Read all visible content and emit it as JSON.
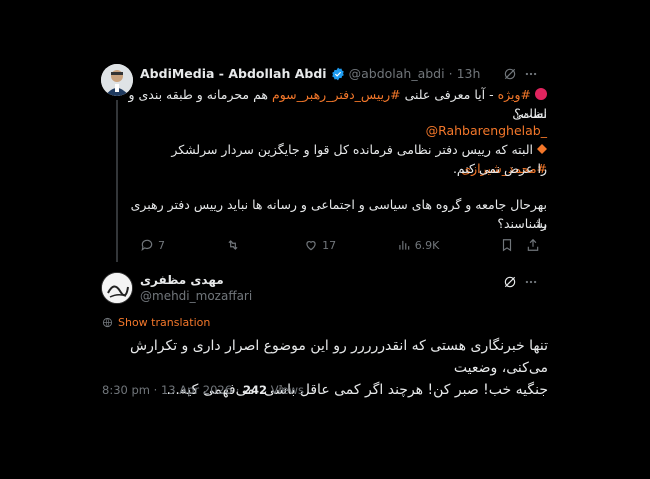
{
  "tweet1": {
    "display_name": "AbdiMedia - Abdollah Abdi",
    "handle": "@abdolah_abdi",
    "dot": "·",
    "time": "13h",
    "line1_prefix": "#ویژه",
    "line1_text_a": " - آیا معرفی علنی ",
    "line1_hashtag": "#رییس_دفتر_رهبر_سوم",
    "line1_text_b": " هم محرمانه و طبقه بندی و نظامی",
    "line2": "است؟",
    "mention": "@Rahbarenghelab_",
    "para2_text_a": "البته که رییس دفتر نظامی فرمانده کل قوا و جایگزین سردار سرلشکر ",
    "para2_hashtag": "#محمد_شیرازی",
    "para2_line2": "را عرض نمی کنم.",
    "para3_line1": "بهرحال جامعه و گروه های سیاسی و اجتماعی و رسانه ها نباید رییس دفتر رهبری را",
    "para3_line2": "بشناسند؟",
    "actions": {
      "replies": "7",
      "retweets": "",
      "likes": "17",
      "views": "6.9K"
    }
  },
  "tweet2": {
    "display_name": "مهدی مظفری",
    "handle": "@mehdi_mozaffari",
    "show_translation": "Show translation",
    "body_line1": "تنها خبرنگاری هستی که انقدررررر رو این موضوع اصرار داری و تکرارش می‌کنی، وضعیت",
    "body_line2": "جنگیه خب! صبر کن! هرچند اگر کمی عاقل باشی، می‌فهمی کیه...",
    "time": "8:30 pm",
    "sep1": "·",
    "date": "13 Apr 2026",
    "sep2": "·",
    "views_count": "242",
    "views_label": "Views"
  },
  "colors": {
    "accent": "#f3772a",
    "verified": "#1d9bf0",
    "muted": "#71767b",
    "background": "#000000"
  },
  "icons": [
    "grok-icon",
    "more-icon",
    "reply-icon",
    "retweet-icon",
    "like-icon",
    "views-icon",
    "bookmark-icon",
    "share-icon",
    "globe-icon",
    "verified-badge-icon",
    "red-circle-icon",
    "orange-diamond-icon"
  ]
}
